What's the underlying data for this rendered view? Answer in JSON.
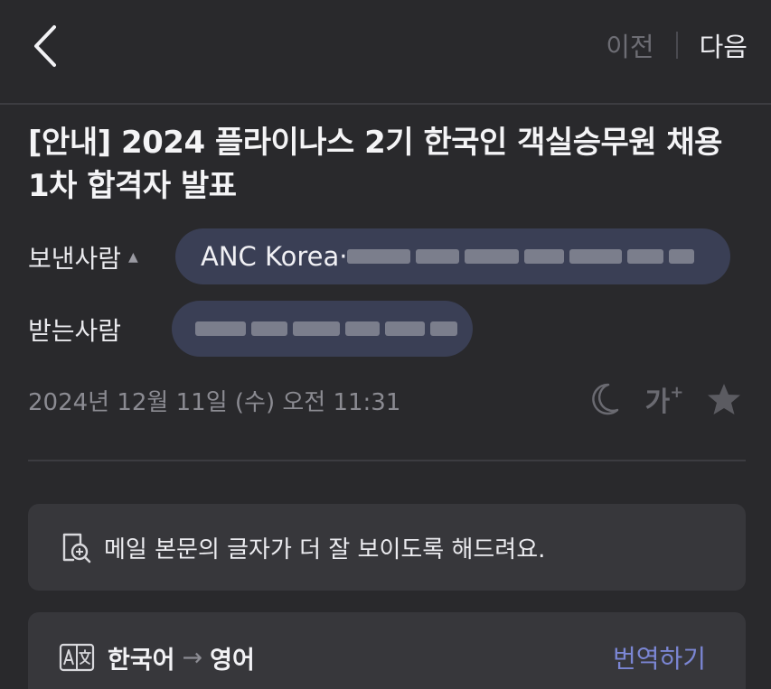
{
  "nav": {
    "prev_label": "이전",
    "next_label": "다음",
    "back_icon": "chevron-left-icon"
  },
  "mail": {
    "subject": "[안내] 2024 플라이나스 2기 한국인 객실승무원 채용 1차 합격자 발표",
    "sender_label": "보낸사람",
    "sender_caret": "▲",
    "sender_name": "ANC Korea·",
    "recipient_label": "받는사람",
    "date": "2024년 12월 11일 (수) 오전 11:31"
  },
  "tools": {
    "dark_mode_icon": "moon-icon",
    "font_size_label": "가",
    "font_size_plus": "+",
    "favorite_icon": "star-icon"
  },
  "zoom_banner": {
    "text": "메일 본문의 글자가 더 잘 보이도록 해드려요."
  },
  "translate_banner": {
    "source_lang": "한국어",
    "arrow": "→",
    "target_lang": "영어",
    "action_label": "번역하기"
  },
  "colors": {
    "background": "#29292c",
    "chip": "#3a3f55",
    "card": "#37373b",
    "accent": "#7b86d4"
  }
}
